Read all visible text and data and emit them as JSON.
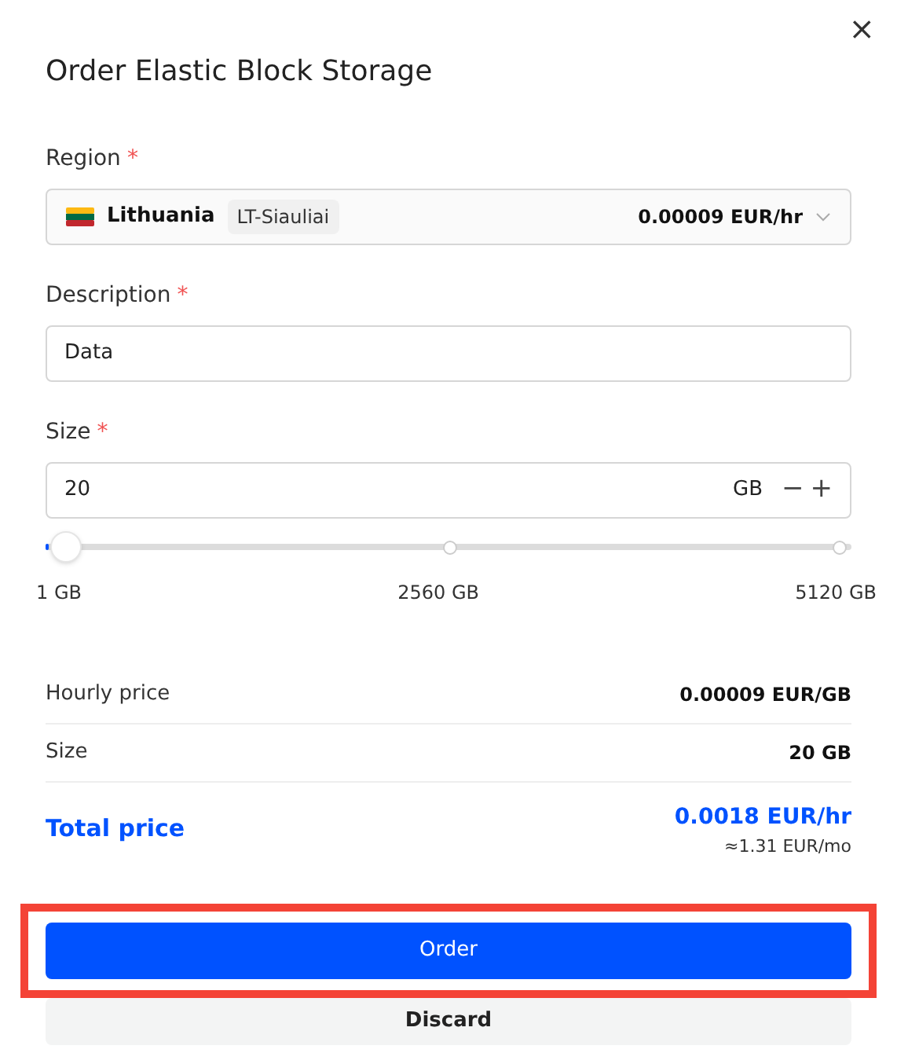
{
  "dialog": {
    "title": "Order Elastic Block Storage",
    "close": "×"
  },
  "region": {
    "label": "Region",
    "required": "*",
    "country": "Lithuania",
    "zone": "LT-Siauliai",
    "price": "0.00009 EUR/hr"
  },
  "description": {
    "label": "Description",
    "required": "*",
    "value": "Data"
  },
  "size": {
    "label": "Size",
    "required": "*",
    "value": "20",
    "unit": "GB",
    "minus": "−",
    "plus": "+",
    "level": 0.004,
    "ticks": [
      "1 GB",
      "2560 GB",
      "5120 GB"
    ]
  },
  "summary": [
    {
      "label": "Hourly price",
      "value": "0.00009 EUR/GB"
    },
    {
      "label": "Size",
      "value": "20 GB"
    }
  ],
  "total": {
    "label": "Total price",
    "value": "0.0018 EUR/hr",
    "monthly": "≈1.31 EUR/mo"
  },
  "buttons": [
    {
      "label": "Order",
      "kind": "primary",
      "highlighted": true
    },
    {
      "label": "Discard",
      "kind": "secondary",
      "highlighted": false
    }
  ]
}
